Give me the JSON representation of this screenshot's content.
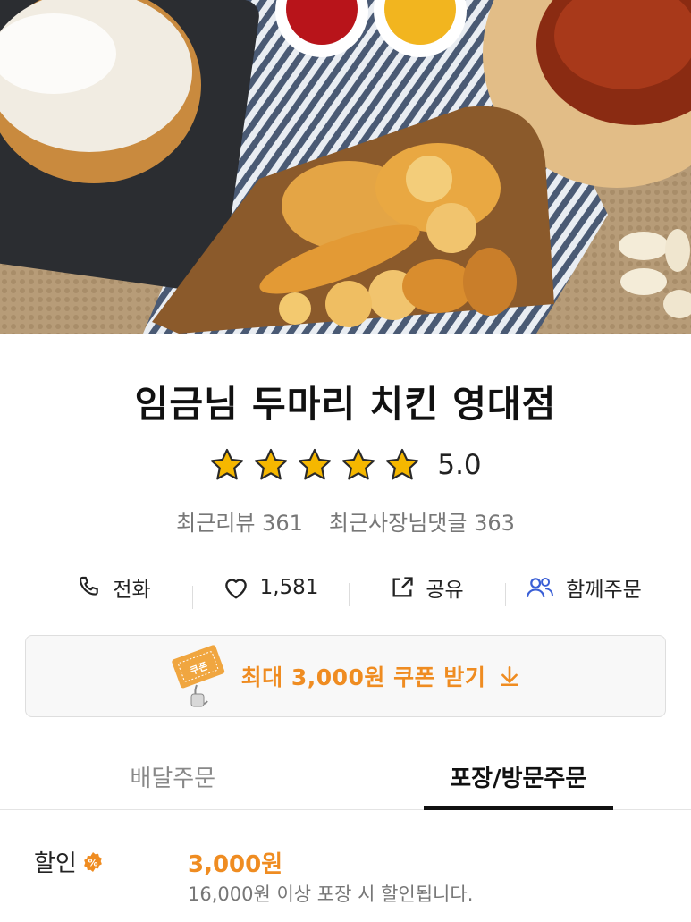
{
  "hero": {
    "image_alt": "fried chicken and sides photo"
  },
  "store": {
    "name": "임금님 두마리 치킨 영대점",
    "rating": "5.0",
    "star_count": 5,
    "recent_reviews_label": "최근리뷰 361",
    "owner_replies_label": "최근사장님댓글 363"
  },
  "actions": {
    "call_label": "전화",
    "like_count": "1,581",
    "share_label": "공유",
    "group_order_label": "함께주문"
  },
  "coupon": {
    "label": "최대 3,000원 쿠폰 받기",
    "ticket_text": "쿠폰"
  },
  "tabs": [
    {
      "label": "배달주문",
      "active": false
    },
    {
      "label": "포장/방문주문",
      "active": true
    }
  ],
  "discount": {
    "label": "할인",
    "badge": "%",
    "amount": "3,000원",
    "description": "16,000원 이상 포장 시 할인됩니다."
  },
  "colors": {
    "accent": "#ef8c21",
    "star": "#f5b700",
    "group_icon": "#3a5fd6"
  }
}
